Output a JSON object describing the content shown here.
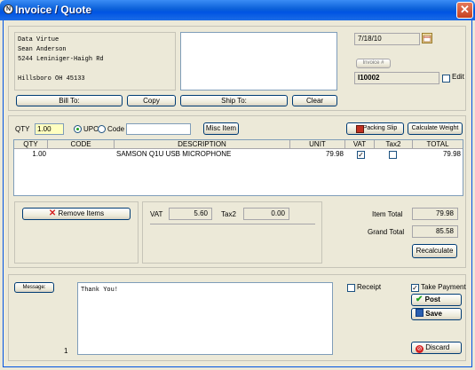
{
  "window": {
    "title": "Invoice / Quote",
    "app_icon_glyph": "N",
    "close_glyph": "✕"
  },
  "address": {
    "bill_lines": [
      "Data Virtue",
      "Sean Anderson",
      "5244 Leniniger-Haigh Rd",
      "",
      "Hillsboro  OH  45133"
    ],
    "ship_lines": [],
    "bill_to_label": "Bill To:",
    "copy_label": "Copy",
    "ship_to_label": "Ship To:",
    "clear_label": "Clear"
  },
  "invoice": {
    "date": "7/18/10",
    "invoice_number_button": "Invoice #",
    "invoice_number": "I10002",
    "edit_label": "Edit",
    "edit_checked": false
  },
  "entry": {
    "qty_label": "QTY",
    "qty_value": "1.00",
    "upc_label": "UPC",
    "code_label": "Code",
    "mode_selected": "UPC",
    "code_value": "",
    "misc_item_label": "Misc Item",
    "packing_slip_label": "Packing Slip",
    "calc_weight_label": "Calculate Weight"
  },
  "items_table": {
    "columns": [
      "QTY",
      "CODE",
      "DESCRIPTION",
      "UNIT",
      "VAT",
      "Tax2",
      "TOTAL"
    ],
    "rows": [
      {
        "qty": "1.00",
        "code": "",
        "description": "SAMSON Q1U USB MICROPHONE",
        "unit": "79.98",
        "vat": true,
        "tax2": false,
        "total": "79.98"
      }
    ]
  },
  "totals": {
    "remove_items_label": "Remove Items",
    "vat_label": "VAT",
    "vat_value": "5.60",
    "tax2_label": "Tax2",
    "tax2_value": "0.00",
    "item_total_label": "Item Total",
    "item_total_value": "79.98",
    "grand_total_label": "Grand Total",
    "grand_total_value": "85.58",
    "recalculate_label": "Recalculate"
  },
  "footer": {
    "message_button": "Message:",
    "message_text": "Thank You!",
    "page_number": "1",
    "receipt_label": "Receipt",
    "receipt_checked": false,
    "take_payment_label": "Take Payment",
    "take_payment_checked": true,
    "post_label": "Post",
    "save_label": "Save",
    "discard_label": "Discard"
  },
  "colors": {
    "titlebar": "#0054e3",
    "qty_field": "#ffffc0",
    "post_check": "#21a121",
    "discard_icon": "#d42020"
  }
}
